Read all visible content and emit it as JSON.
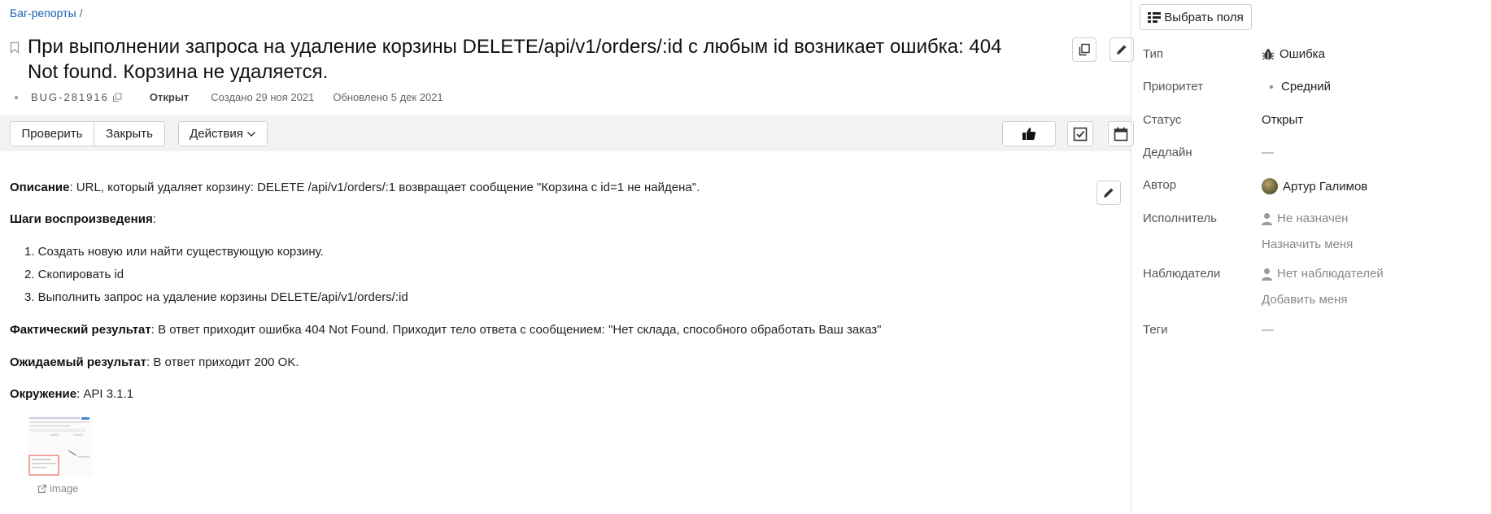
{
  "breadcrumb": {
    "link": "Баг-репорты",
    "separator": "/"
  },
  "issue": {
    "title": "При выполнении запроса на удаление корзины DELETE/api/v1/orders/:id с любым id возникает ошибка: 404 Not found. Корзина не удаляется.",
    "key": "BUG-281916",
    "status": "Открыт",
    "created": "Создано 29 ноя 2021",
    "updated": "Обновлено 5 дек 2021"
  },
  "toolbar": {
    "check_label": "Проверить",
    "close_label": "Закрыть",
    "actions_label": "Действия"
  },
  "description": {
    "description_label": "Описание",
    "description_text": ": URL, который удаляет корзину: DELETE /api/v1/orders/:1 возвращает сообщение \"Корзина с id=1 не найдена\".",
    "steps_label": "Шаги воспроизведения",
    "steps_colon": ":",
    "steps": [
      "1. Создать новую или найти существующую корзину.",
      "2. Скопировать id",
      "3. Выполнить запрос на удаление корзины DELETE/api/v1/orders/:id"
    ],
    "actual_label": "Фактический результат",
    "actual_text": ": В ответ приходит ошибка 404 Not Found. Приходит тело ответа с сообщением: \"Нет склада, способного обработать Ваш заказ\"",
    "expected_label": "Ожидаемый результат",
    "expected_text": ": В ответ приходит 200 OK.",
    "env_label": "Окружение",
    "env_text": ": API 3.1.1",
    "attachment_label": "image"
  },
  "sidebar": {
    "fields_button": "Выбрать поля",
    "type_label": "Тип",
    "type_value": "Ошибка",
    "priority_label": "Приоритет",
    "priority_value": "Средний",
    "status_label": "Статус",
    "status_value": "Открыт",
    "deadline_label": "Дедлайн",
    "deadline_value": "—",
    "author_label": "Автор",
    "author_value": "Артур Галимов",
    "assignee_label": "Исполнитель",
    "assignee_value": "Не назначен",
    "assign_me": "Назначить меня",
    "watchers_label": "Наблюдатели",
    "watchers_value": "Нет наблюдателей",
    "add_me": "Добавить меня",
    "tags_label": "Теги",
    "tags_value": "—"
  },
  "icons": [
    "bookmark-icon",
    "copy-icon",
    "edit-icon",
    "thumbs-up-icon",
    "checklist-icon",
    "calendar-icon",
    "bug-icon",
    "user-icon",
    "external-link-icon",
    "list-icon",
    "chevron-down-icon"
  ],
  "colors": {
    "link": "#1a5fb4",
    "toolbar_bg": "#f3f3f3"
  }
}
